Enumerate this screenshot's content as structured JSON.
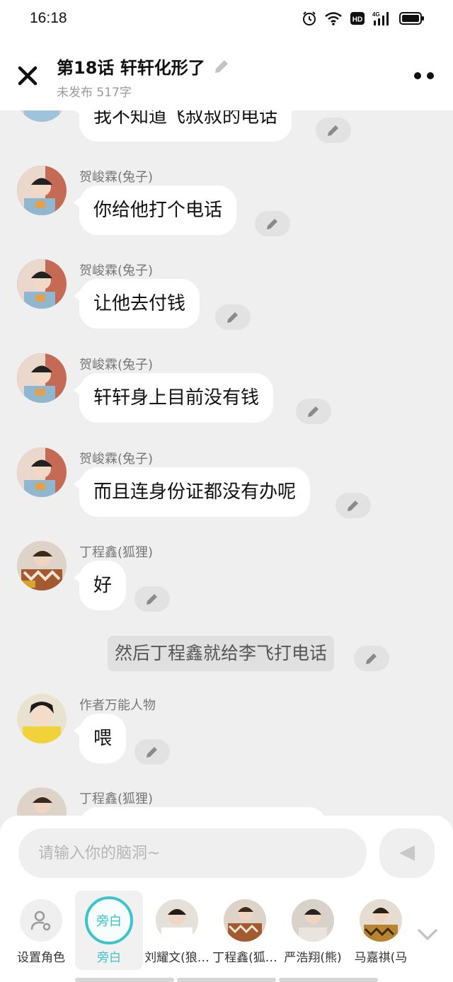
{
  "status_bar": {
    "time": "16:18",
    "icons": [
      "alarm-icon",
      "wifi-icon",
      "hd-icon",
      "signal-4g-icon",
      "battery-icon"
    ],
    "network": "4G",
    "hd": "HD"
  },
  "header": {
    "title": "第18话 轩轩化形了",
    "subtitle": "未发布 517字"
  },
  "messages": [
    {
      "sender": "",
      "text": "我不知道飞叔叔的电话"
    },
    {
      "sender": "贺峻霖(兔子)",
      "text": "你给他打个电话"
    },
    {
      "sender": "贺峻霖(兔子)",
      "text": "让他去付钱"
    },
    {
      "sender": "贺峻霖(兔子)",
      "text": "轩轩身上目前没有钱"
    },
    {
      "sender": "贺峻霖(兔子)",
      "text": "而且连身份证都没有办呢"
    },
    {
      "sender": "丁程鑫(狐狸)",
      "text": "好"
    },
    {
      "sender": "作者万能人物",
      "text": "喂"
    },
    {
      "sender": "丁程鑫(狐狸)",
      "text": ""
    }
  ],
  "narration": "然后丁程鑫就给李飞打电话",
  "composer": {
    "placeholder": "请输入你的脑洞~"
  },
  "roles": [
    {
      "label": "设置角色"
    },
    {
      "label": "旁白",
      "badge": "旁白"
    },
    {
      "label": "刘耀文(狼…"
    },
    {
      "label": "丁程鑫(狐…"
    },
    {
      "label": "严浩翔(熊)"
    },
    {
      "label": "马嘉祺(马"
    }
  ],
  "colors": {
    "accent": "#3cc4c8",
    "chat_bg": "#efefef",
    "bubble": "#ffffff"
  }
}
